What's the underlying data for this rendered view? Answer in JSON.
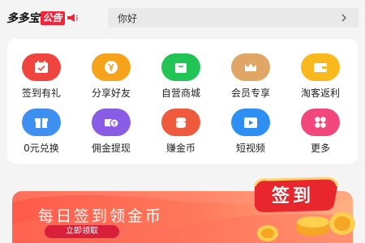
{
  "notice": {
    "brand_name": "多多宝",
    "brand_tag": "公告",
    "text": "你好"
  },
  "menu": {
    "items": [
      {
        "label": "签到有礼",
        "icon": "calendar-icon",
        "color": "#f0453f"
      },
      {
        "label": "分享好友",
        "icon": "yen-coin-icon",
        "color": "#f7a21b"
      },
      {
        "label": "自营商城",
        "icon": "shopping-bag-icon",
        "color": "#22c456"
      },
      {
        "label": "会员专享",
        "icon": "crown-icon",
        "color": "#e0a665"
      },
      {
        "label": "淘客返利",
        "icon": "wallet-icon",
        "color": "#f9b81c"
      },
      {
        "label": "0元兑换",
        "icon": "gift-icon",
        "color": "#3d8ff0"
      },
      {
        "label": "佣金提现",
        "icon": "cash-withdraw-icon",
        "color": "#8a5ce6"
      },
      {
        "label": "赚金币",
        "icon": "coin-stack-icon",
        "color": "#f05a3c"
      },
      {
        "label": "短视频",
        "icon": "video-icon",
        "color": "#2e8ff2"
      },
      {
        "label": "更多",
        "icon": "more-grid-icon",
        "color": "#f2477d"
      }
    ]
  },
  "banner": {
    "title": "每日签到领金币",
    "button": "立即领取",
    "badge": "签到"
  }
}
